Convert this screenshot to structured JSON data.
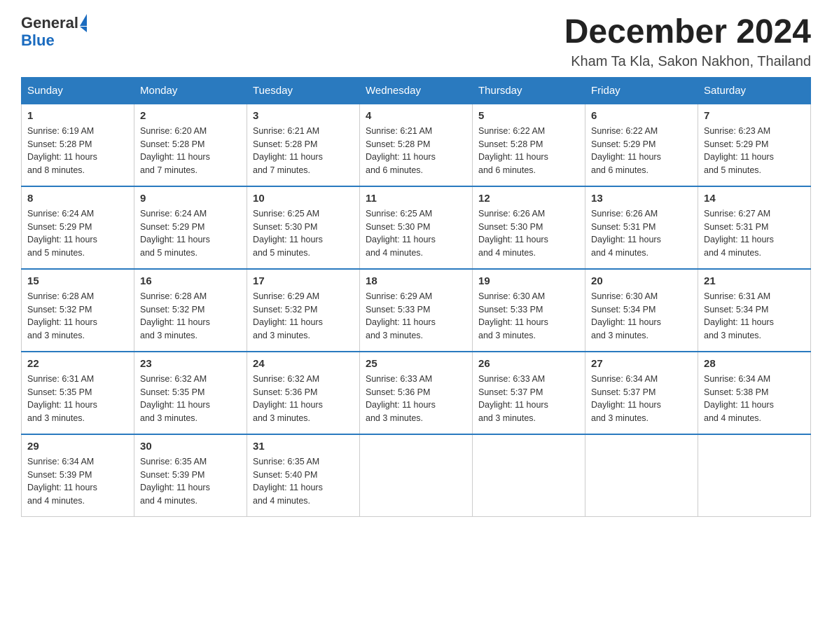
{
  "header": {
    "logo_general": "General",
    "logo_blue": "Blue",
    "month_title": "December 2024",
    "location": "Kham Ta Kla, Sakon Nakhon, Thailand"
  },
  "days_of_week": [
    "Sunday",
    "Monday",
    "Tuesday",
    "Wednesday",
    "Thursday",
    "Friday",
    "Saturday"
  ],
  "weeks": [
    [
      {
        "day": "1",
        "sunrise": "6:19 AM",
        "sunset": "5:28 PM",
        "daylight": "11 hours and 8 minutes."
      },
      {
        "day": "2",
        "sunrise": "6:20 AM",
        "sunset": "5:28 PM",
        "daylight": "11 hours and 7 minutes."
      },
      {
        "day": "3",
        "sunrise": "6:21 AM",
        "sunset": "5:28 PM",
        "daylight": "11 hours and 7 minutes."
      },
      {
        "day": "4",
        "sunrise": "6:21 AM",
        "sunset": "5:28 PM",
        "daylight": "11 hours and 6 minutes."
      },
      {
        "day": "5",
        "sunrise": "6:22 AM",
        "sunset": "5:28 PM",
        "daylight": "11 hours and 6 minutes."
      },
      {
        "day": "6",
        "sunrise": "6:22 AM",
        "sunset": "5:29 PM",
        "daylight": "11 hours and 6 minutes."
      },
      {
        "day": "7",
        "sunrise": "6:23 AM",
        "sunset": "5:29 PM",
        "daylight": "11 hours and 5 minutes."
      }
    ],
    [
      {
        "day": "8",
        "sunrise": "6:24 AM",
        "sunset": "5:29 PM",
        "daylight": "11 hours and 5 minutes."
      },
      {
        "day": "9",
        "sunrise": "6:24 AM",
        "sunset": "5:29 PM",
        "daylight": "11 hours and 5 minutes."
      },
      {
        "day": "10",
        "sunrise": "6:25 AM",
        "sunset": "5:30 PM",
        "daylight": "11 hours and 5 minutes."
      },
      {
        "day": "11",
        "sunrise": "6:25 AM",
        "sunset": "5:30 PM",
        "daylight": "11 hours and 4 minutes."
      },
      {
        "day": "12",
        "sunrise": "6:26 AM",
        "sunset": "5:30 PM",
        "daylight": "11 hours and 4 minutes."
      },
      {
        "day": "13",
        "sunrise": "6:26 AM",
        "sunset": "5:31 PM",
        "daylight": "11 hours and 4 minutes."
      },
      {
        "day": "14",
        "sunrise": "6:27 AM",
        "sunset": "5:31 PM",
        "daylight": "11 hours and 4 minutes."
      }
    ],
    [
      {
        "day": "15",
        "sunrise": "6:28 AM",
        "sunset": "5:32 PM",
        "daylight": "11 hours and 3 minutes."
      },
      {
        "day": "16",
        "sunrise": "6:28 AM",
        "sunset": "5:32 PM",
        "daylight": "11 hours and 3 minutes."
      },
      {
        "day": "17",
        "sunrise": "6:29 AM",
        "sunset": "5:32 PM",
        "daylight": "11 hours and 3 minutes."
      },
      {
        "day": "18",
        "sunrise": "6:29 AM",
        "sunset": "5:33 PM",
        "daylight": "11 hours and 3 minutes."
      },
      {
        "day": "19",
        "sunrise": "6:30 AM",
        "sunset": "5:33 PM",
        "daylight": "11 hours and 3 minutes."
      },
      {
        "day": "20",
        "sunrise": "6:30 AM",
        "sunset": "5:34 PM",
        "daylight": "11 hours and 3 minutes."
      },
      {
        "day": "21",
        "sunrise": "6:31 AM",
        "sunset": "5:34 PM",
        "daylight": "11 hours and 3 minutes."
      }
    ],
    [
      {
        "day": "22",
        "sunrise": "6:31 AM",
        "sunset": "5:35 PM",
        "daylight": "11 hours and 3 minutes."
      },
      {
        "day": "23",
        "sunrise": "6:32 AM",
        "sunset": "5:35 PM",
        "daylight": "11 hours and 3 minutes."
      },
      {
        "day": "24",
        "sunrise": "6:32 AM",
        "sunset": "5:36 PM",
        "daylight": "11 hours and 3 minutes."
      },
      {
        "day": "25",
        "sunrise": "6:33 AM",
        "sunset": "5:36 PM",
        "daylight": "11 hours and 3 minutes."
      },
      {
        "day": "26",
        "sunrise": "6:33 AM",
        "sunset": "5:37 PM",
        "daylight": "11 hours and 3 minutes."
      },
      {
        "day": "27",
        "sunrise": "6:34 AM",
        "sunset": "5:37 PM",
        "daylight": "11 hours and 3 minutes."
      },
      {
        "day": "28",
        "sunrise": "6:34 AM",
        "sunset": "5:38 PM",
        "daylight": "11 hours and 4 minutes."
      }
    ],
    [
      {
        "day": "29",
        "sunrise": "6:34 AM",
        "sunset": "5:39 PM",
        "daylight": "11 hours and 4 minutes."
      },
      {
        "day": "30",
        "sunrise": "6:35 AM",
        "sunset": "5:39 PM",
        "daylight": "11 hours and 4 minutes."
      },
      {
        "day": "31",
        "sunrise": "6:35 AM",
        "sunset": "5:40 PM",
        "daylight": "11 hours and 4 minutes."
      },
      null,
      null,
      null,
      null
    ]
  ],
  "labels": {
    "sunrise_prefix": "Sunrise: ",
    "sunset_prefix": "Sunset: ",
    "daylight_prefix": "Daylight: "
  }
}
